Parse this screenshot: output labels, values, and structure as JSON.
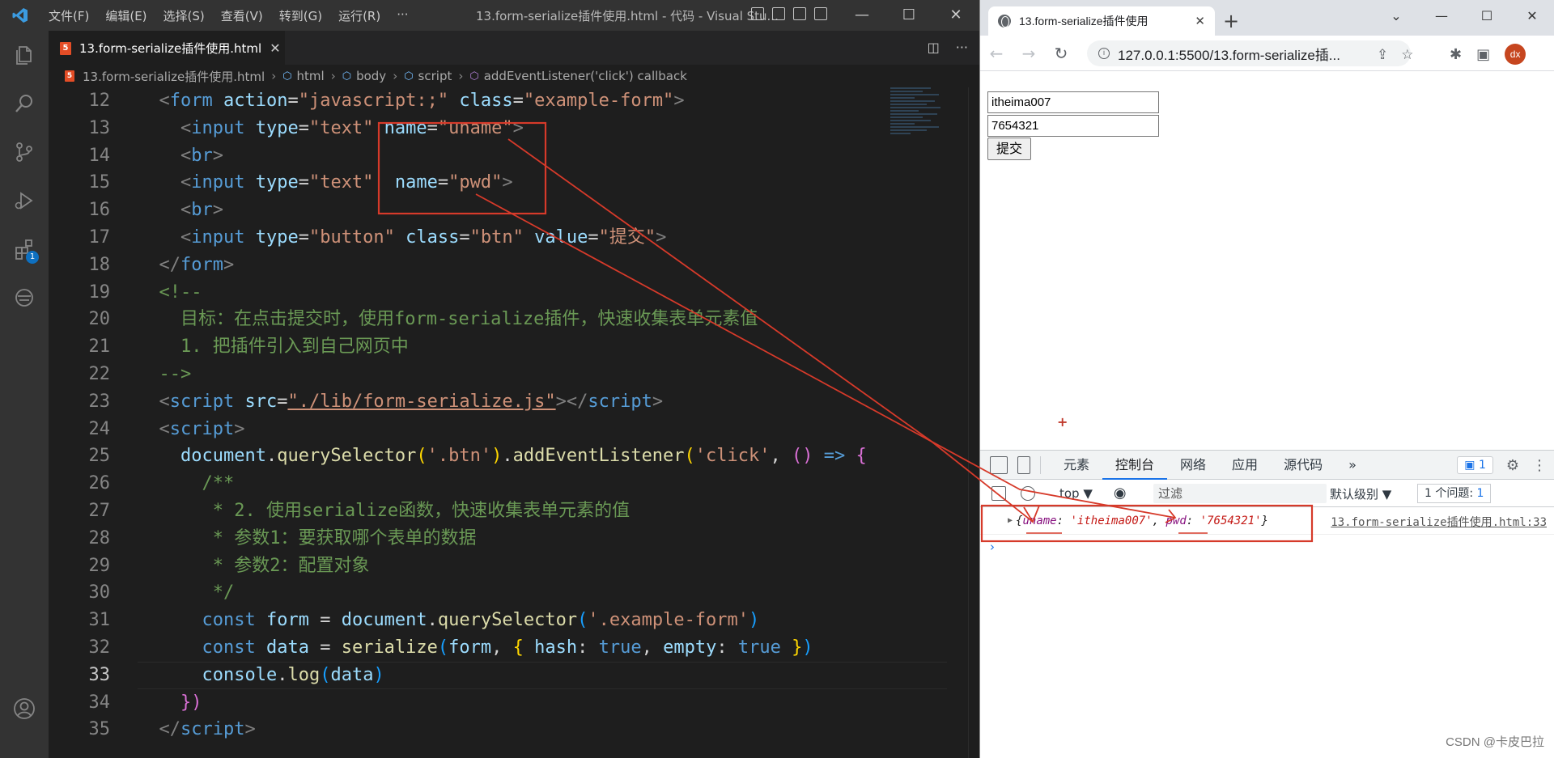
{
  "vscode": {
    "menu": [
      "文件(F)",
      "编辑(E)",
      "选择(S)",
      "查看(V)",
      "转到(G)",
      "运行(R)",
      "···"
    ],
    "window_title": "13.form-serialize插件使用.html - 代码 - Visual Stu...",
    "activity_badge": "1",
    "tab": {
      "label": "13.form-serialize插件使用.html",
      "close": "✕",
      "icon_text": "5"
    },
    "breadcrumb": [
      "13.form-serialize插件使用.html",
      "html",
      "body",
      "script",
      "addEventListener('click') callback"
    ],
    "line_numbers": [
      "12",
      "13",
      "14",
      "15",
      "16",
      "17",
      "18",
      "19",
      "20",
      "21",
      "22",
      "23",
      "24",
      "25",
      "26",
      "27",
      "28",
      "29",
      "30",
      "31",
      "32",
      "33",
      "34",
      "35"
    ],
    "current_line": "33"
  },
  "browser": {
    "tab_title": "13.form-serialize插件使用",
    "tab_close": "✕",
    "new_tab": "+",
    "url": "127.0.0.1:5500/13.form-serialize插...",
    "avatar": "dx",
    "page": {
      "uname_value": "itheima007",
      "pwd_value": "7654321",
      "submit_label": "提交"
    },
    "devtools": {
      "tabs": [
        "元素",
        "控制台",
        "网络",
        "应用",
        "源代码",
        "»"
      ],
      "active_tab": "控制台",
      "message_badge": "1",
      "context": "top ▼",
      "filter_placeholder": "过滤",
      "levels": "默认级别 ▼",
      "issues_label": "1 个问题:",
      "issues_count": "1",
      "log": {
        "open": "{",
        "k1": "uname",
        "v1": "'itheima007'",
        "k2": "pwd",
        "v2": "'7654321'",
        "close": "}",
        "source": "13.form-serialize插件使用.html:33"
      },
      "prompt": "›"
    }
  },
  "watermark": "CSDN @卡皮巴拉",
  "colors": {
    "annotation": "#d63a2a",
    "accent": "#1a73e8",
    "vscode_bg": "#1e1e1e"
  }
}
